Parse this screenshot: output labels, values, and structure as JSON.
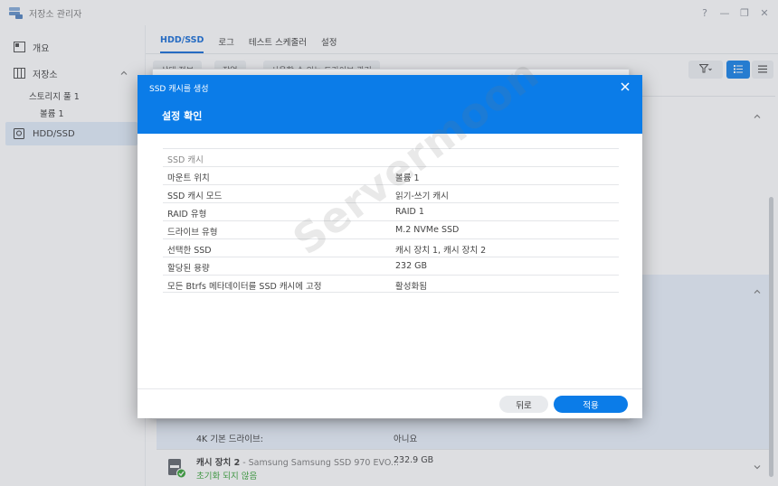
{
  "window": {
    "title": "저장소 관리자",
    "controls": [
      "?",
      "—",
      "❐",
      "✕"
    ]
  },
  "sidebar": {
    "items": [
      {
        "label": "개요",
        "icon": "overview-icon"
      },
      {
        "label": "저장소",
        "icon": "storage-icon"
      },
      {
        "label": "HDD/SSD",
        "icon": "hdd-icon"
      }
    ],
    "storage_pool": "스토리지 풀 1",
    "volume": "볼륨 1"
  },
  "main": {
    "tabs": [
      "HDD/SSD",
      "로그",
      "테스트 스케줄러",
      "설정"
    ],
    "toolbar": {
      "btn1": "상태 정보",
      "btn2": "작업",
      "btn3": "사용할 수 있는 드라이브 관리"
    },
    "rows": {
      "row1_key": "4K 기본 드라이브:",
      "row1_val": "아니요"
    },
    "device": {
      "name": "캐시 장치 2",
      "model": " - Samsung Samsung SSD 970 EVO...",
      "status": "초기화 되지 않음",
      "size": "232.9 GB"
    }
  },
  "dialog": {
    "title": "SSD 캐시를 생성",
    "subtitle": "설정 확인",
    "section": "SSD 캐시",
    "rows": [
      {
        "key": "마운트 위치",
        "value": "볼륨 1"
      },
      {
        "key": "SSD 캐시 모드",
        "value": "읽기-쓰기 캐시"
      },
      {
        "key": "RAID 유형",
        "value": "RAID 1"
      },
      {
        "key": "드라이브 유형",
        "value": "M.2 NVMe SSD"
      },
      {
        "key": "선택한 SSD",
        "value": "캐시 장치 1, 캐시 장치 2"
      },
      {
        "key": "할당된 용량",
        "value": "232 GB"
      },
      {
        "key": "모든 Btrfs 메타데이터를 SSD 캐시에 고정",
        "value": "활성화됨"
      }
    ],
    "back_label": "뒤로",
    "apply_label": "적용"
  },
  "watermark": "Servermoon",
  "colors": {
    "accent": "#0b7ce8",
    "selected": "#e1ecfa",
    "success": "#2d9f2d"
  }
}
